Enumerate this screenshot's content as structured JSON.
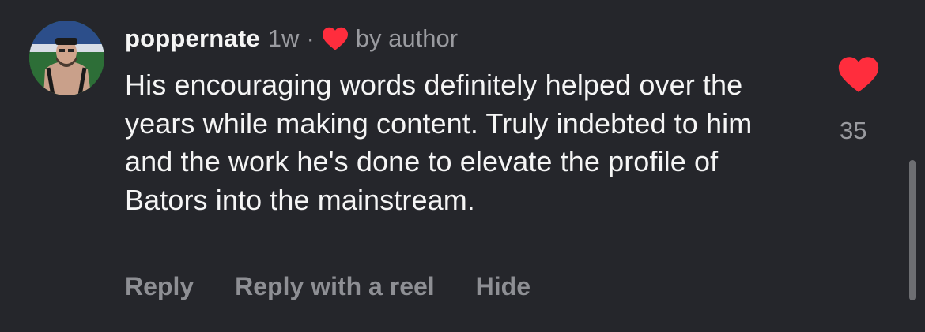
{
  "comment": {
    "username": "poppernate",
    "time": "1w",
    "separator": "·",
    "liked_by_author_label": "by author",
    "text": "His encouraging words definitely helped over the years while making content. Truly indebted to him and the work he's done to elevate the profile of Bators into the mainstream.",
    "like_count": "35",
    "actions": {
      "reply": "Reply",
      "reply_with_reel": "Reply with a reel",
      "hide": "Hide"
    }
  },
  "colors": {
    "background": "#25262b",
    "heart": "#ff2d3d",
    "secondary_text": "#9a9ba0"
  },
  "icons": {
    "author_like": "heart-icon",
    "like_button": "heart-icon"
  }
}
